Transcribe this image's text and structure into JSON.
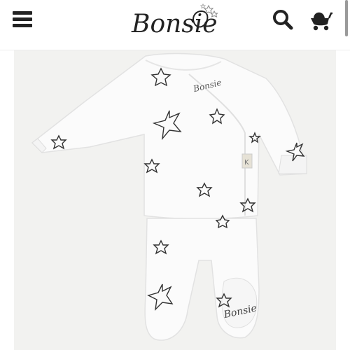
{
  "header": {
    "logo_text": "Bonsie",
    "menu_icon": "hamburger-menu-icon",
    "search_icon": "search-icon",
    "cart_icon": "stroller-cart-icon"
  },
  "product": {
    "image_logo_text": "Bonsie",
    "image_label": "K"
  },
  "colors": {
    "icon": "#222222",
    "image_background": "#f2f2f0",
    "garment": "#fbfbfb",
    "star_stroke": "#333333"
  }
}
